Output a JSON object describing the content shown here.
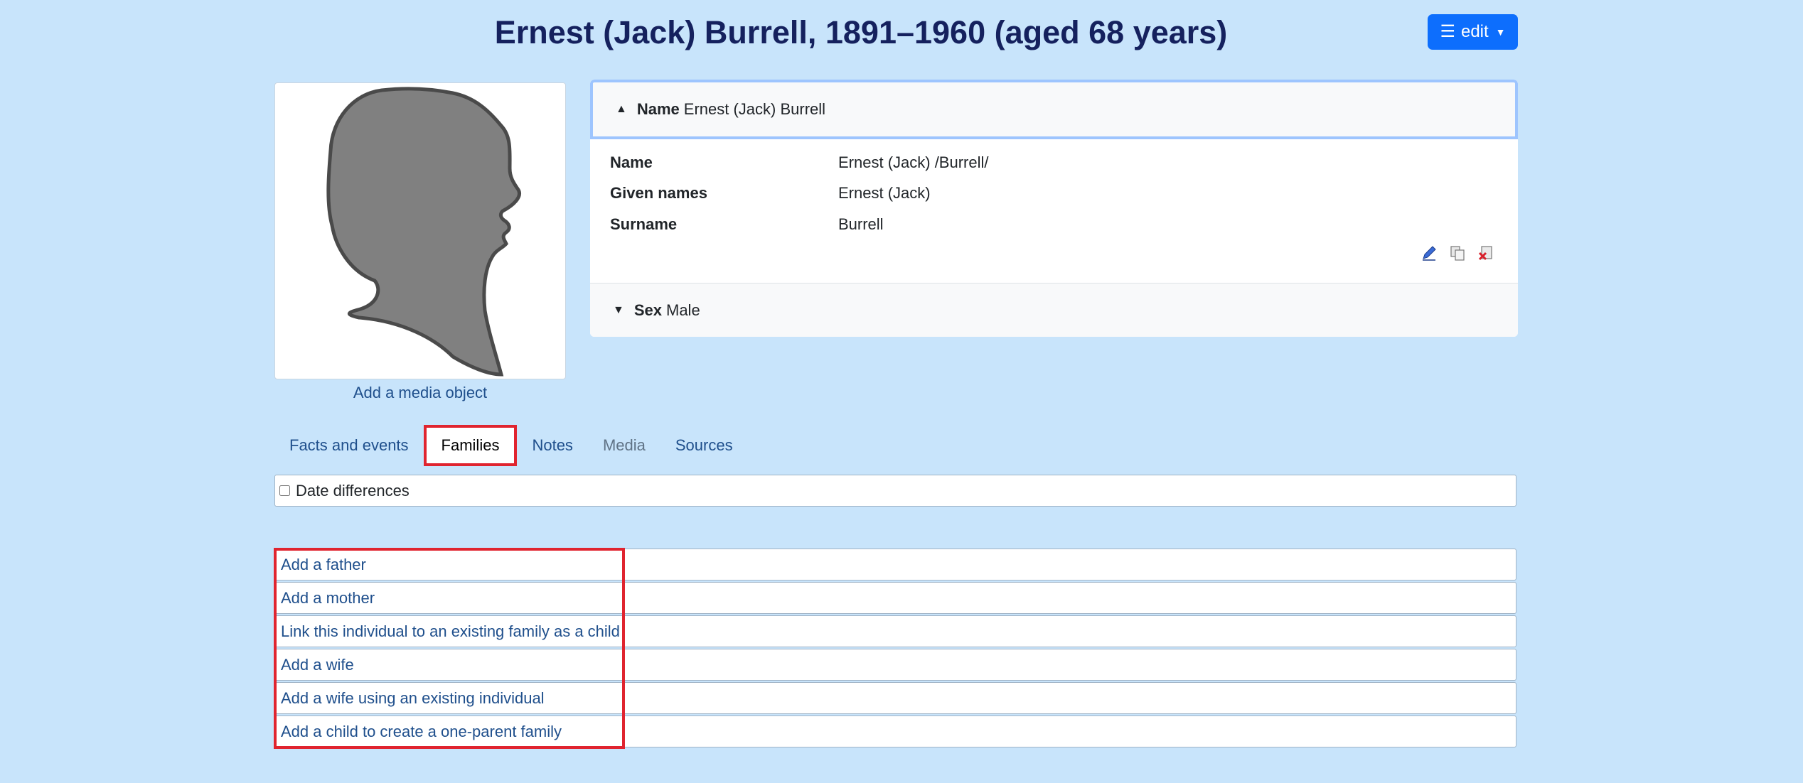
{
  "header": {
    "title": "Ernest (Jack) Burrell, 1891–1960 (aged 68 years)",
    "edit_label": "edit",
    "edit_icon": "menu-icon",
    "edit_caret": "caret-down-icon"
  },
  "media": {
    "placeholder_icon": "silhouette-male-icon",
    "add_label": "Add a media object"
  },
  "name_section": {
    "header_label": "Name",
    "header_value": "Ernest (Jack) Burrell",
    "facts": [
      {
        "label": "Name",
        "value": "Ernest (Jack) /Burrell/"
      },
      {
        "label": "Given names",
        "value": "Ernest (Jack)"
      },
      {
        "label": "Surname",
        "value": "Burrell"
      }
    ],
    "icons": [
      "edit-pencil-icon",
      "copy-icon",
      "delete-icon"
    ]
  },
  "sex_section": {
    "label": "Sex",
    "value": "Male"
  },
  "tabs": [
    {
      "label": "Facts and events",
      "state": "normal"
    },
    {
      "label": "Families",
      "state": "active"
    },
    {
      "label": "Notes",
      "state": "normal"
    },
    {
      "label": "Media",
      "state": "disabled"
    },
    {
      "label": "Sources",
      "state": "normal"
    }
  ],
  "families": {
    "date_differences_label": "Date differences",
    "date_differences_checked": false,
    "links": [
      "Add a father",
      "Add a mother",
      "Link this individual to an existing family as a child",
      "Add a wife",
      "Add a wife using an existing individual",
      "Add a child to create a one-parent family"
    ]
  },
  "colors": {
    "background": "#c8e4fb",
    "title": "#15215e",
    "link": "#1f4f8c",
    "primary_button": "#0d6efd",
    "highlight": "#e0242f"
  }
}
